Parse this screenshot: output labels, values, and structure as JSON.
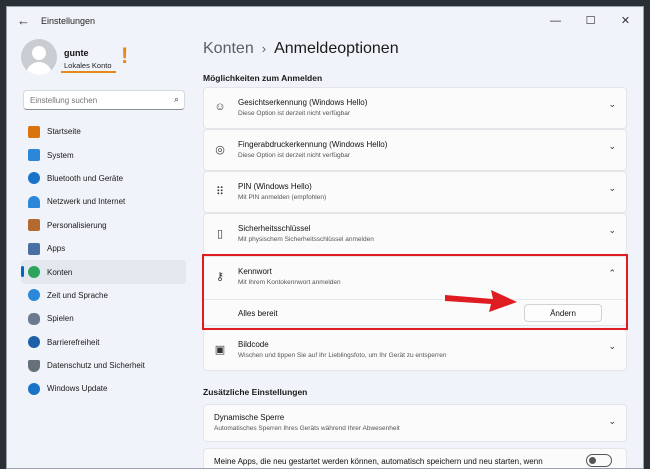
{
  "window": {
    "title": "Einstellungen"
  },
  "user": {
    "name": "gunte",
    "account_type": "Lokales Konto",
    "mark": "!"
  },
  "search": {
    "placeholder": "Einstellung suchen"
  },
  "sidebar": {
    "items": [
      {
        "label": "Startseite",
        "icon": "home-icon",
        "color": "#d9730d"
      },
      {
        "label": "System",
        "icon": "system-icon",
        "color": "#2b88d8"
      },
      {
        "label": "Bluetooth und Geräte",
        "icon": "bluetooth-icon",
        "color": "#1a73c9"
      },
      {
        "label": "Netzwerk und Internet",
        "icon": "wifi-icon",
        "color": "#2b88d8"
      },
      {
        "label": "Personalisierung",
        "icon": "brush-icon",
        "color": "#b46a2f"
      },
      {
        "label": "Apps",
        "icon": "apps-icon",
        "color": "#4a6fa5"
      },
      {
        "label": "Konten",
        "icon": "person-icon",
        "color": "#2ca55a",
        "active": true
      },
      {
        "label": "Zeit und Sprache",
        "icon": "clock-icon",
        "color": "#2b88d8"
      },
      {
        "label": "Spielen",
        "icon": "gamepad-icon",
        "color": "#6b7a8f"
      },
      {
        "label": "Barrierefreiheit",
        "icon": "accessibility-icon",
        "color": "#1d5fa8"
      },
      {
        "label": "Datenschutz und Sicherheit",
        "icon": "shield-icon",
        "color": "#66707a"
      },
      {
        "label": "Windows Update",
        "icon": "update-icon",
        "color": "#1a73c9"
      }
    ]
  },
  "breadcrumb": {
    "parent": "Konten",
    "current": "Anmeldeoptionen"
  },
  "sections": {
    "signin_heading": "Möglichkeiten zum Anmelden",
    "additional_heading": "Zusätzliche Einstellungen"
  },
  "options": [
    {
      "title": "Gesichtserkennung (Windows Hello)",
      "desc": "Diese Option ist derzeit nicht verfügbar",
      "icon": "face-icon"
    },
    {
      "title": "Fingerabdruckerkennung (Windows Hello)",
      "desc": "Diese Option ist derzeit nicht verfügbar",
      "icon": "fingerprint-icon"
    },
    {
      "title": "PIN (Windows Hello)",
      "desc": "Mit PIN anmelden (empfohlen)",
      "icon": "keypad-icon"
    },
    {
      "title": "Sicherheitsschlüssel",
      "desc": "Mit physischem Sicherheitsschlüssel anmelden",
      "icon": "usb-key-icon"
    },
    {
      "title": "Kennwort",
      "desc": "Mit Ihrem Kontokennwort anmelden",
      "icon": "key-icon",
      "expanded": true,
      "status": "Alles bereit",
      "button": "Ändern"
    },
    {
      "title": "Bildcode",
      "desc": "Wischen und tippen Sie auf Ihr Lieblingsfoto, um Ihr Gerät zu entsperren",
      "icon": "picture-icon"
    }
  ],
  "additional": [
    {
      "title": "Dynamische Sperre",
      "desc": "Automatisches Sperren Ihres Geräts während Ihrer Abwesenheit"
    },
    {
      "title": "Meine Apps, die neu gestartet werden können, automatisch speichern und neu starten, wenn"
    }
  ],
  "colors": {
    "accent": "#0067c0",
    "highlight_red": "#e01c23",
    "annotation_orange": "#e88a18"
  }
}
